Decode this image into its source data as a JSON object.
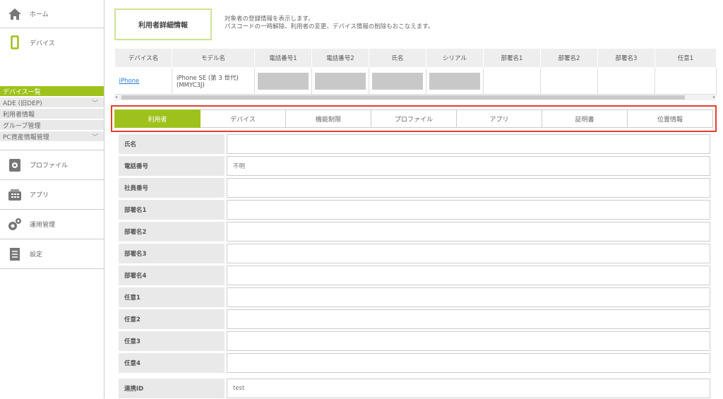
{
  "sidebar": {
    "home_label": "ホーム",
    "device_label": "デバイス",
    "sub_items": [
      {
        "label": "デバイス一覧"
      },
      {
        "label": "ADE (旧DEP)"
      },
      {
        "label": "利用者情報"
      },
      {
        "label": "グループ管理"
      },
      {
        "label": "PC資産情報管理"
      }
    ],
    "profile_label": "プロファイル",
    "app_label": "アプリ",
    "operation_label": "運用管理",
    "settings_label": "設定"
  },
  "header": {
    "title": "利用者詳細情報",
    "desc_line1": "対象者の登録情報を表示します。",
    "desc_line2": "パスコードの一時解除、利用者の変更、デバイス情報の削除もおこなえます。"
  },
  "device_table": {
    "headers": [
      "デバイス名",
      "モデル名",
      "電話番号1",
      "電話番号2",
      "氏名",
      "シリアル",
      "部署名1",
      "部署名2",
      "部署名3",
      "任意1"
    ],
    "row": {
      "device_name": "iPhone",
      "model_line1": "iPhone SE (第 3 世代)",
      "model_line2": "(MMYC3J)"
    }
  },
  "tabs": [
    "利用者",
    "デバイス",
    "機能制限",
    "プロファイル",
    "アプリ",
    "証明書",
    "位置情報"
  ],
  "form": {
    "fields": [
      {
        "label": "氏名",
        "value": ""
      },
      {
        "label": "電話番号",
        "value": "不明"
      },
      {
        "label": "社員番号",
        "value": ""
      },
      {
        "label": "部署名1",
        "value": ""
      },
      {
        "label": "部署名2",
        "value": ""
      },
      {
        "label": "部署名3",
        "value": ""
      },
      {
        "label": "部署名4",
        "value": ""
      },
      {
        "label": "任意1",
        "value": ""
      },
      {
        "label": "任意2",
        "value": ""
      },
      {
        "label": "任意3",
        "value": ""
      },
      {
        "label": "任意4",
        "value": ""
      }
    ],
    "link_id": {
      "label": "連携ID",
      "value": "test"
    }
  },
  "colors": {
    "accent": "#9ec21c",
    "highlight": "#e53d2c"
  }
}
